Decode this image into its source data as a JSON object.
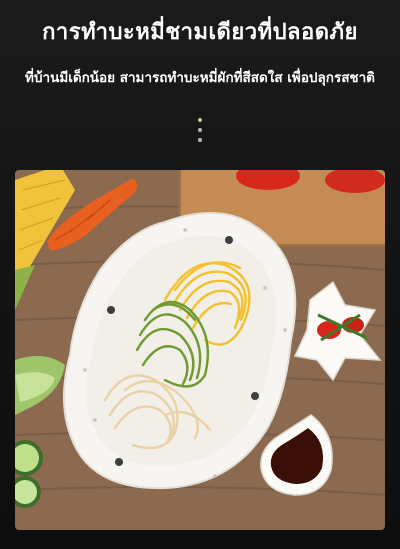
{
  "header": {
    "title": "การทำบะหมี่ชามเดียวที่ปลอดภัย",
    "subtitle": "ที่บ้านมีเด็กน้อย สามารถทำบะหมี่ผักที่สีสดใส เพื่อปลุกรสชาติ"
  },
  "indicator": {
    "dots": 3
  },
  "photo": {
    "icons": [
      "corn-icon",
      "carrot-icon",
      "cutting-board-icon",
      "tomato-icon",
      "plate-icon",
      "yellow-noodle-icon",
      "green-noodle-icon",
      "plain-noodle-icon",
      "star-dish-icon",
      "sauce-dish-icon",
      "cucumber-icon"
    ],
    "colors": {
      "wood": "#8b6a50",
      "plate": "#f7f5f1",
      "yellow_noodle": "#f2c12e",
      "green_noodle": "#6f9a2f",
      "plain_noodle": "#e9d2a8",
      "sauce": "#3b0f08"
    }
  }
}
